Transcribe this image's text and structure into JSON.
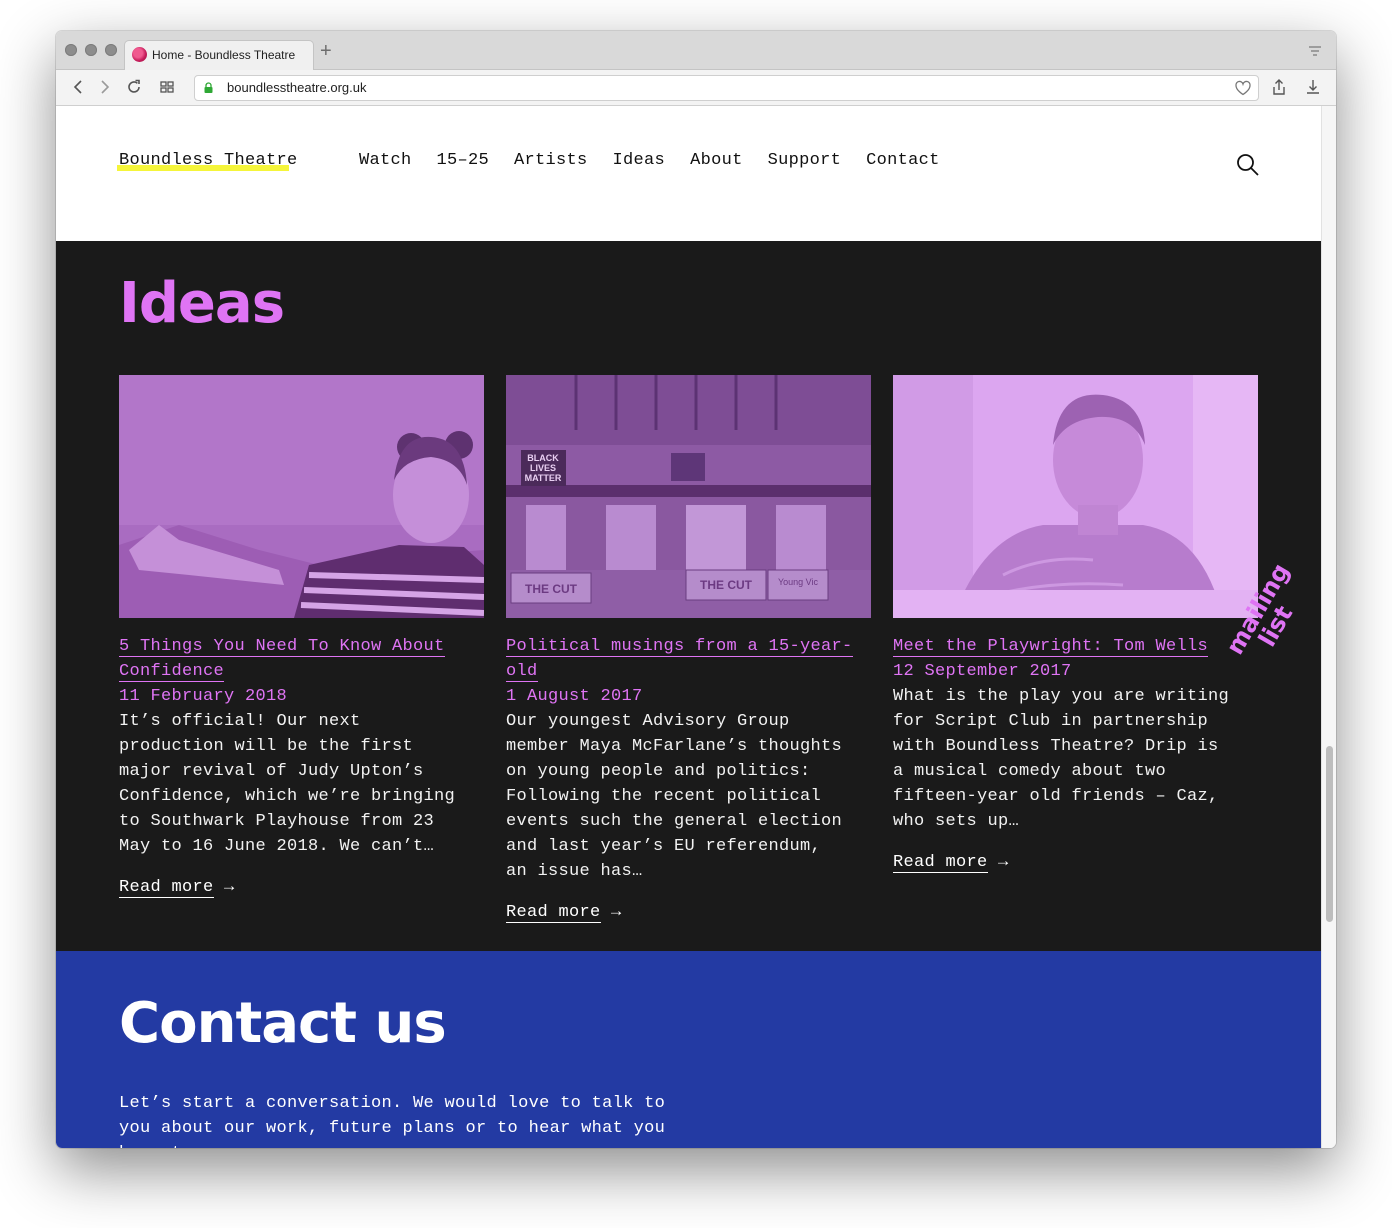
{
  "browser": {
    "tab_title": "Home - Boundless Theatre",
    "url": "boundlesstheatre.org.uk"
  },
  "site": {
    "logo": "Boundless Theatre",
    "nav": [
      "Watch",
      "15–25",
      "Artists",
      "Ideas",
      "About",
      "Support",
      "Contact"
    ]
  },
  "ideas": {
    "title": "Ideas",
    "cards": [
      {
        "title_line1": "5 Things You Need To Know About",
        "title_line2": "Confidence",
        "date": "11 February 2018",
        "excerpt": "It’s official! Our next\nproduction will be the first\nmajor revival of Judy Upton’s\nConfidence, which we’re bringing\nto Southwark Playhouse from 23\nMay  to 16 June 2018.  We can’t…",
        "read_more": "Read more"
      },
      {
        "title_line1": "Political musings from a 15-year-old",
        "title_line2": "",
        "date": "1 August 2017",
        "excerpt": "Our youngest Advisory Group\nmember Maya McFarlane’s thoughts\non young people and politics:\nFollowing the recent political\nevents such the general election\nand last year’s EU referendum,\nan issue has…",
        "read_more": "Read more"
      },
      {
        "title_line1": "Meet the Playwright: Tom Wells",
        "title_line2": "",
        "date": "12 September 2017",
        "excerpt": "What is the play you are writing\nfor Script Club in partnership\nwith Boundless Theatre? Drip is\na musical comedy about two\nfifteen-year old friends – Caz,\nwho sets up…",
        "read_more": "Read more"
      }
    ],
    "mailing_line1": "mailing",
    "mailing_line2": "list",
    "photo_signs": {
      "blm1": "BLACK",
      "blm2": "LIVES",
      "blm3": "MATTER",
      "cut1": "THE CUT",
      "cut2": "THE CUT",
      "yv": "Young Vic"
    }
  },
  "contact": {
    "title": "Contact us",
    "text": "Let’s start a conversation. We would love to talk to you about our work, future plans or to hear what you have to"
  },
  "colors": {
    "accent_purple": "#df74f4",
    "dark_bg": "#1a1a1a",
    "contact_blue": "#233aa3",
    "logo_highlight": "#f5f53a"
  }
}
